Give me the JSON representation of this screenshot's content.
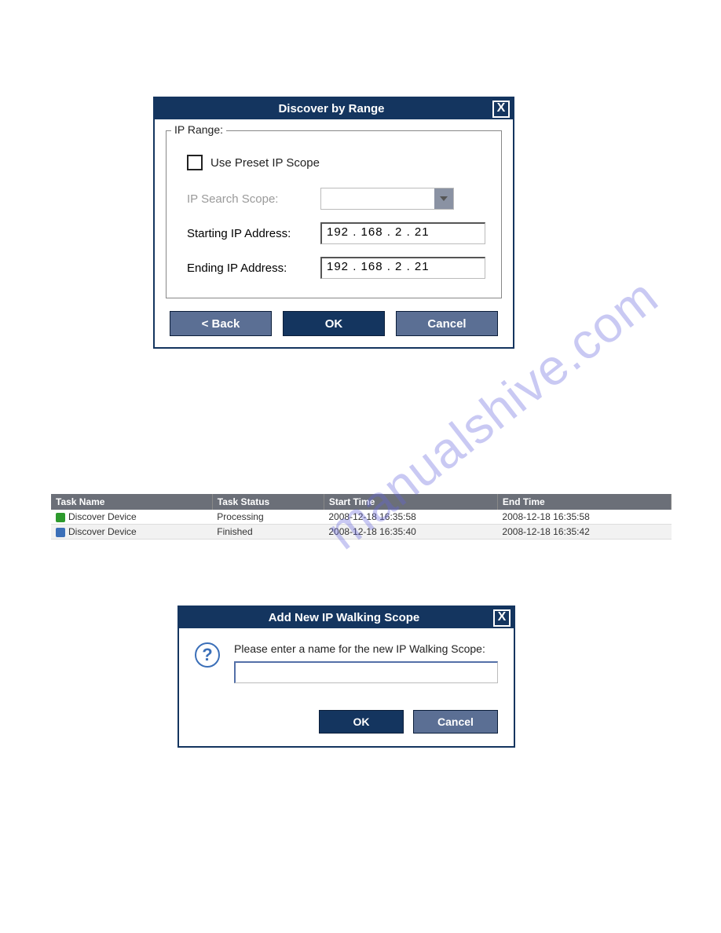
{
  "dialog1": {
    "title": "Discover by Range",
    "close": "X",
    "legend": "IP Range:",
    "use_preset_label": "Use Preset IP Scope",
    "search_scope_label": "IP Search Scope:",
    "starting_label": "Starting IP Address:",
    "starting_value": "192  .  168  .   2   .  21",
    "ending_label": "Ending IP Address:",
    "ending_value": "192  .  168  .   2   .  21",
    "back_label": "< Back",
    "ok_label": "OK",
    "cancel_label": "Cancel"
  },
  "table": {
    "headers": {
      "name": "Task Name",
      "status": "Task Status",
      "start": "Start Time",
      "end": "End Time"
    },
    "rows": [
      {
        "name": "Discover Device",
        "status": "Processing",
        "start": "2008-12-18 16:35:58",
        "end": "2008-12-18 16:35:58"
      },
      {
        "name": "Discover Device",
        "status": "Finished",
        "start": "2008-12-18 16:35:40",
        "end": "2008-12-18 16:35:42"
      }
    ]
  },
  "dialog2": {
    "title": "Add New IP Walking Scope",
    "close": "X",
    "prompt": "Please enter a name for the new IP Walking Scope:",
    "ok_label": "OK",
    "cancel_label": "Cancel"
  },
  "watermark": "manualshive.com"
}
